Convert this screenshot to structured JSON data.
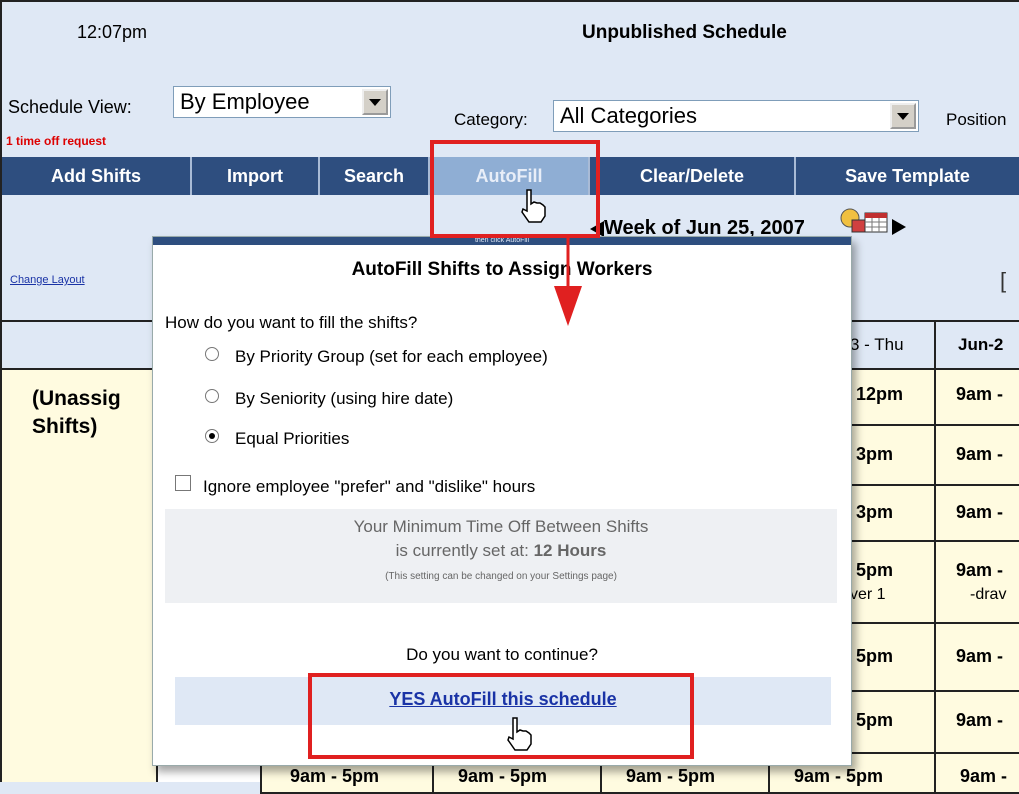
{
  "header": {
    "time": "12:07pm",
    "title": "Unpublished Schedule"
  },
  "controls": {
    "schedule_view_label": "Schedule View:",
    "schedule_view_value": "By Employee",
    "time_off_notice": "1 time off request",
    "category_label": "Category:",
    "category_value": "All Categories",
    "position_label": "Position"
  },
  "toolbar": {
    "buttons": [
      "Add Shifts",
      "Import",
      "Search",
      "AutoFill",
      "Clear/Delete",
      "Save Template"
    ]
  },
  "nav": {
    "week_label": "Week of Jun 25, 2007",
    "change_layout": "Change Layout"
  },
  "grid": {
    "headers": [
      "3 - Thu",
      "Jun-2"
    ],
    "unassigned_line1": "(Unassig",
    "unassigned_line2": "Shifts)",
    "col_thu": [
      "12pm",
      "3pm",
      "3pm",
      "5pm",
      "5pm",
      "5pm"
    ],
    "col_thu_extra": "ver 1",
    "col_fri": [
      "9am -",
      "9am -",
      "9am -",
      "9am -",
      "9am -",
      "9am -"
    ],
    "col_fri_extra": "-drav",
    "bottom_row": [
      "9am - 5pm",
      "9am - 5pm",
      "9am - 5pm",
      "9am - 5pm",
      "9am -"
    ]
  },
  "dialog": {
    "subtitle": "then click AutoFill",
    "title": "AutoFill Shifts to Assign Workers",
    "question": "How do you want to fill the shifts?",
    "options": [
      {
        "label": "By Priority Group (set for each employee)",
        "checked": false
      },
      {
        "label": "By Seniority (using hire date)",
        "checked": false
      },
      {
        "label": "Equal Priorities",
        "checked": true
      }
    ],
    "ignore_label": "Ignore employee \"prefer\" and \"dislike\" hours",
    "info_line1": "Your Minimum Time Off Between Shifts",
    "info_line2_prefix": "is currently set at:",
    "info_line2_value": "12  Hours",
    "info_note": "(This setting can be changed on your Settings page)",
    "continue_question": "Do you want to continue?",
    "yes_link": "YES  AutoFill this schedule"
  },
  "colors": {
    "toolbar": "#2e4e7f",
    "toolbar_active": "#8faed4",
    "highlight": "#e02020",
    "link": "#1a33a6",
    "cell_bg": "#fffbe0"
  }
}
